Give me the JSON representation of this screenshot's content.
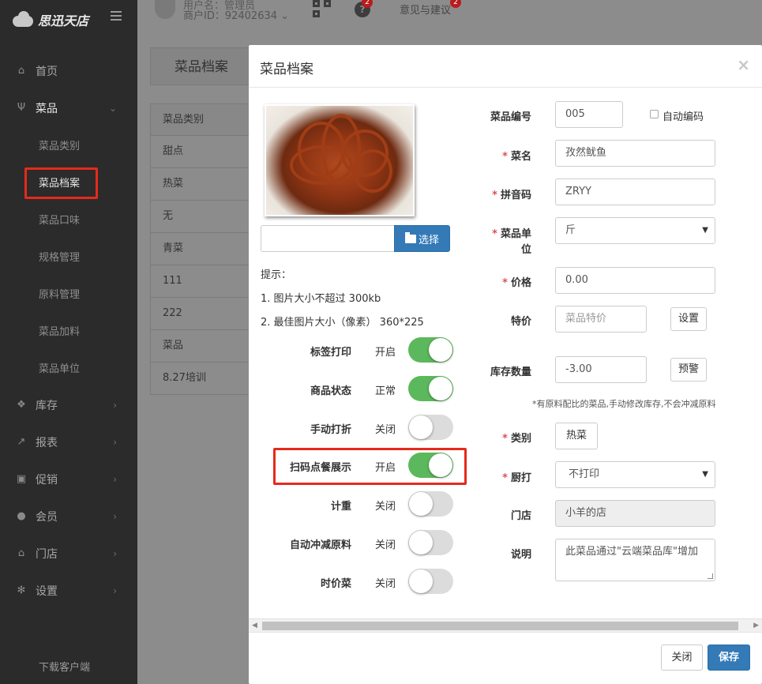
{
  "app": {
    "logo_text": "思迅天店"
  },
  "header": {
    "user_name": "用户名：管理员",
    "merchant_id": "商户ID：92402634",
    "help_badge": "2",
    "feedback_label": "意见与建议",
    "feedback_badge": "2"
  },
  "sidebar": {
    "items": [
      {
        "label": "首页",
        "icon": "home-icon"
      },
      {
        "label": "菜品",
        "icon": "cutlery-icon"
      },
      {
        "label": "库存",
        "icon": "cubes-icon"
      },
      {
        "label": "报表",
        "icon": "chart-icon"
      },
      {
        "label": "促销",
        "icon": "gift-icon"
      },
      {
        "label": "会员",
        "icon": "users-icon"
      },
      {
        "label": "门店",
        "icon": "bank-icon"
      },
      {
        "label": "设置",
        "icon": "gear-icon"
      }
    ],
    "sub_items": [
      "菜品类别",
      "菜品档案",
      "菜品口味",
      "规格管理",
      "原料管理",
      "菜品加料",
      "菜品单位"
    ],
    "download_label": "下载客户端"
  },
  "background": {
    "tab_label": "菜品档案",
    "table_header": "菜品类别",
    "rows": [
      "甜点",
      "热菜",
      "无",
      "青菜",
      "111",
      "222",
      "菜品",
      "8.27培训"
    ]
  },
  "modal": {
    "title": "菜品档案",
    "close_symbol": "×",
    "select_button": "选择",
    "hint_title": "提示：",
    "hint_1": "1. 图片大小不超过 300kb",
    "hint_2": "2. 最佳图片大小（像素） 360*225",
    "switches": [
      {
        "label": "标签打印",
        "state": "开启",
        "on": true
      },
      {
        "label": "商品状态",
        "state": "正常",
        "on": true
      },
      {
        "label": "手动打折",
        "state": "关闭",
        "on": false
      },
      {
        "label": "扫码点餐展示",
        "state": "开启",
        "on": true
      },
      {
        "label": "计重",
        "state": "关闭",
        "on": false
      },
      {
        "label": "自动冲减原料",
        "state": "关闭",
        "on": false
      },
      {
        "label": "时价菜",
        "state": "关闭",
        "on": false
      }
    ],
    "fields": {
      "code_label": "菜品编号",
      "code_value": "005",
      "auto_code_label": "自动编码",
      "name_label": "菜名",
      "name_value": "孜然鱿鱼",
      "pinyin_label": "拼音码",
      "pinyin_value": "ZRYY",
      "unit_label_1": "菜品单",
      "unit_label_2": "位",
      "unit_value": "斤",
      "price_label": "价格",
      "price_value": "0.00",
      "special_label": "特价",
      "special_placeholder": "菜品特价",
      "special_button": "设置",
      "stock_label": "库存数量",
      "stock_value": "-3.00",
      "stock_button": "预警",
      "stock_note": "*有原料配比的菜品,手动修改库存,不会冲减原料",
      "category_label": "类别",
      "category_value": "热菜",
      "kitchen_label": "厨打",
      "kitchen_value": "不打印",
      "store_label": "门店",
      "store_value": "小羊的店",
      "desc_label": "说明",
      "desc_value": "此菜品通过\"云端菜品库\"增加"
    },
    "footer": {
      "close_label": "关闭",
      "save_label": "保存"
    }
  },
  "colors": {
    "primary": "#337ab7",
    "switch_on": "#5cb85c",
    "highlight": "#e52a1b",
    "required": "#d9534f"
  }
}
